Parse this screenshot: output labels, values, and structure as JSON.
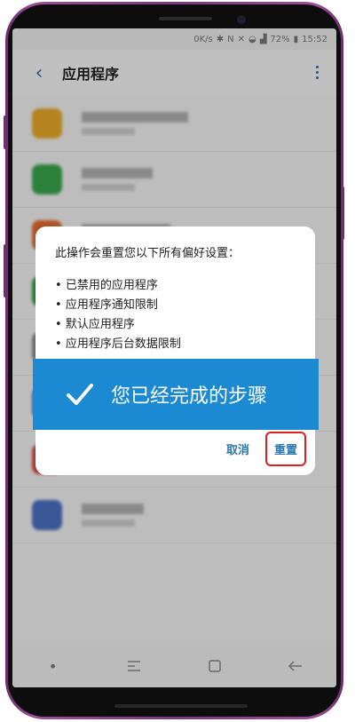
{
  "status_bar": {
    "net_speed": "0K/s",
    "battery": "72%",
    "time": "15:52"
  },
  "app_bar": {
    "title": "应用程序"
  },
  "dialog": {
    "message": "此操作会重置您以下所有偏好设置：",
    "items": [
      "已禁用的应用程序",
      "应用程序通知限制",
      "默认应用程序",
      "应用程序后台数据限制"
    ],
    "cancel_label": "取消",
    "reset_label": "重置",
    "highlight_color": "#e01e1e"
  },
  "banner": {
    "text": "您已经完成的步骤",
    "color": "#1b8ad3",
    "icon": "check-icon"
  },
  "app_list": {
    "icon_colors": [
      "#e8a92a",
      "#3aa54a",
      "#e06a2a",
      "#2e9c3e",
      "#888888",
      "#4a78c8",
      "#d64b3b",
      "#4a70c0"
    ]
  },
  "nav_bar": {
    "icons": [
      "dot-icon",
      "recent-apps-icon",
      "home-icon",
      "back-icon"
    ]
  }
}
